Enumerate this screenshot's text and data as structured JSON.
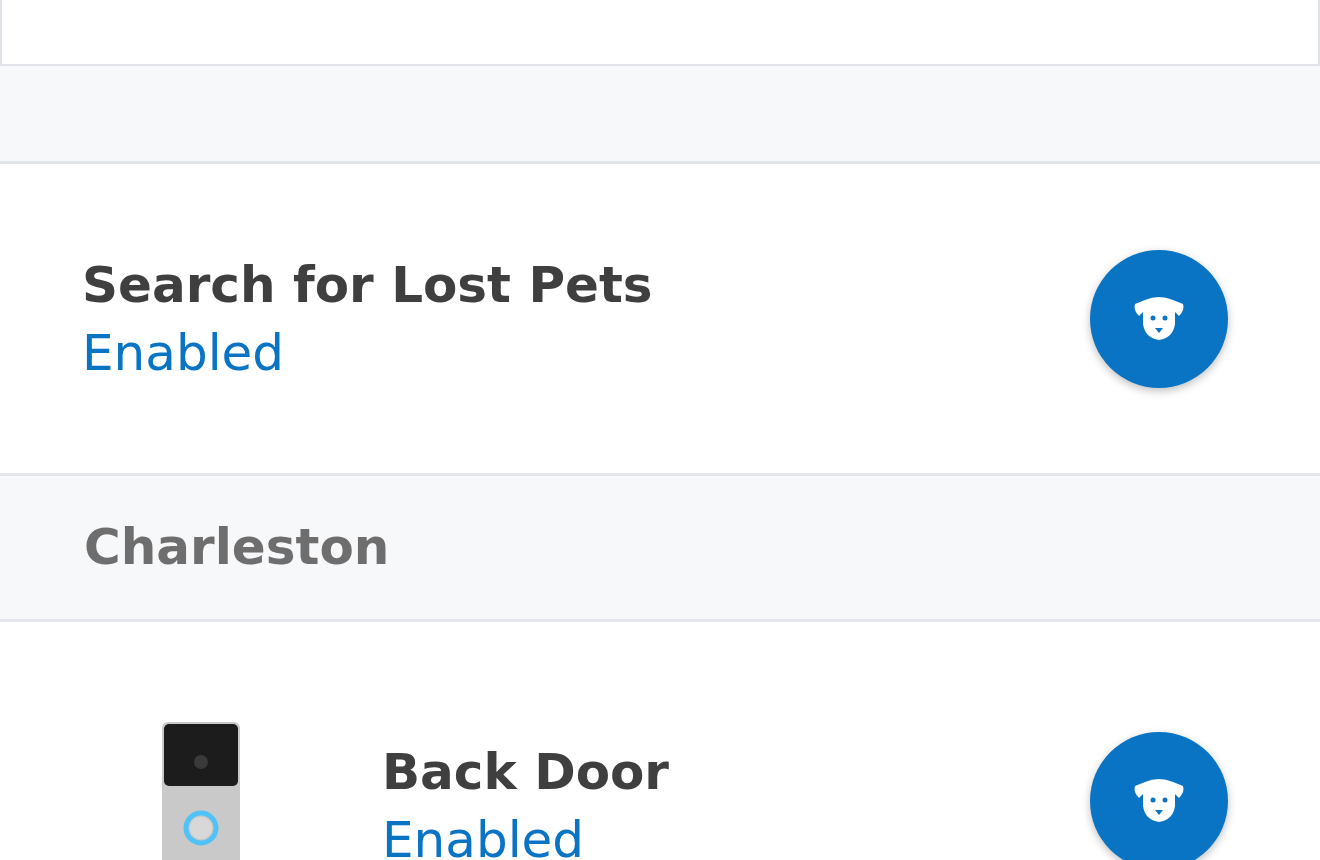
{
  "feature": {
    "title": "Search for Lost Pets",
    "status": "Enabled",
    "enabled": true
  },
  "section": {
    "title": "Charleston"
  },
  "devices": [
    {
      "name": "Back Door",
      "status": "Enabled",
      "enabled": true
    }
  ]
}
